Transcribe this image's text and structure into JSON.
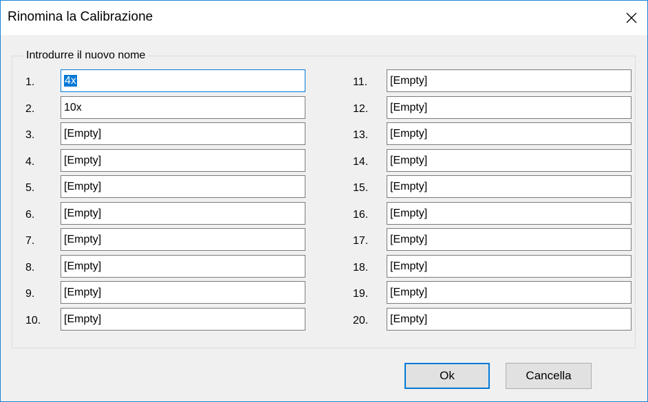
{
  "window": {
    "title": "Rinomina la Calibrazione"
  },
  "group": {
    "label": "Introdurre il nuovo nome"
  },
  "selected_text": "4x",
  "left_rows": [
    {
      "num": "1.",
      "value": ""
    },
    {
      "num": "2.",
      "value": "10x"
    },
    {
      "num": "3.",
      "value": "[Empty]"
    },
    {
      "num": "4.",
      "value": "[Empty]"
    },
    {
      "num": "5.",
      "value": "[Empty]"
    },
    {
      "num": "6.",
      "value": "[Empty]"
    },
    {
      "num": "7.",
      "value": "[Empty]"
    },
    {
      "num": "8.",
      "value": "[Empty]"
    },
    {
      "num": "9.",
      "value": "[Empty]"
    },
    {
      "num": "10.",
      "value": "[Empty]"
    }
  ],
  "right_rows": [
    {
      "num": "11.",
      "value": "[Empty]"
    },
    {
      "num": "12.",
      "value": "[Empty]"
    },
    {
      "num": "13.",
      "value": "[Empty]"
    },
    {
      "num": "14.",
      "value": "[Empty]"
    },
    {
      "num": "15.",
      "value": "[Empty]"
    },
    {
      "num": "16.",
      "value": "[Empty]"
    },
    {
      "num": "17.",
      "value": "[Empty]"
    },
    {
      "num": "18.",
      "value": "[Empty]"
    },
    {
      "num": "19.",
      "value": "[Empty]"
    },
    {
      "num": "20.",
      "value": "[Empty]"
    }
  ],
  "buttons": {
    "ok": "Ok",
    "cancel": "Cancella"
  }
}
